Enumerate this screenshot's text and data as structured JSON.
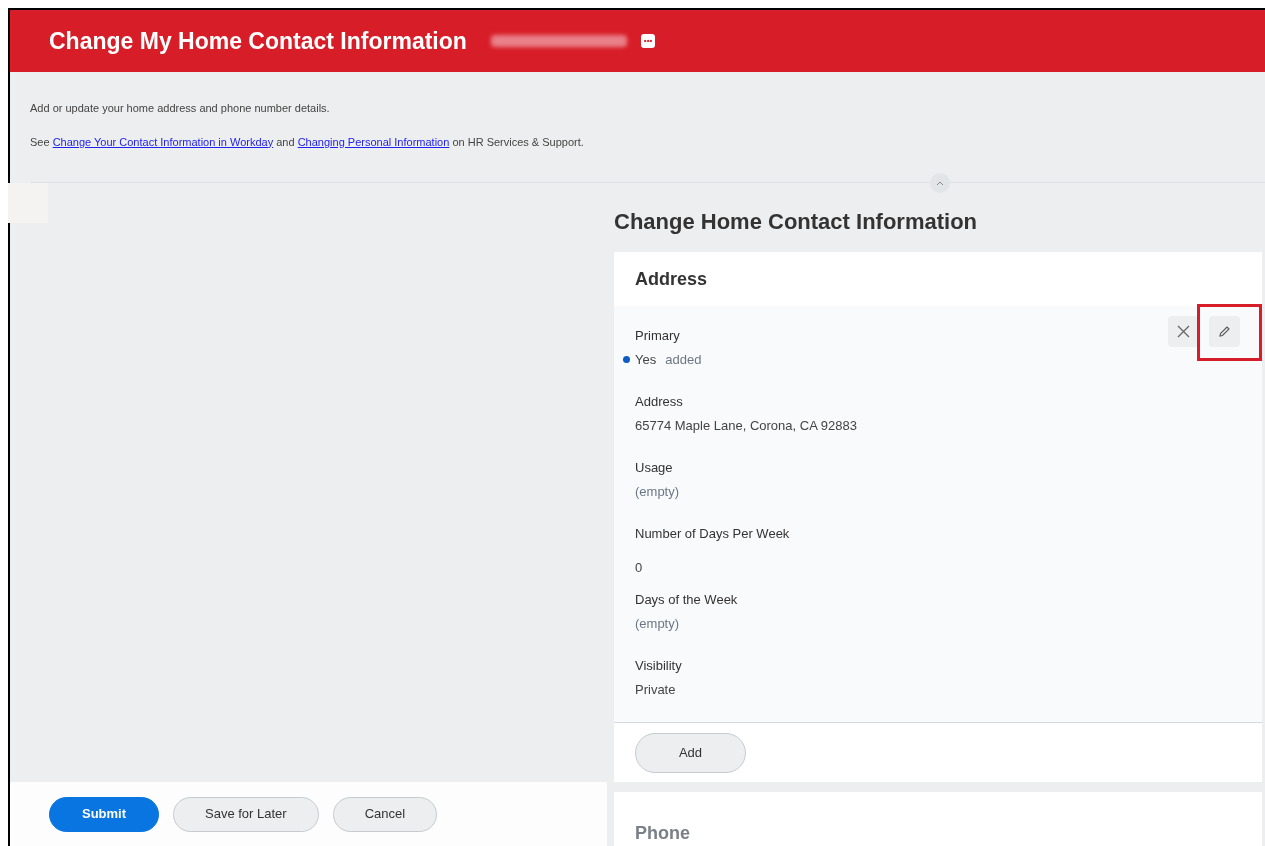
{
  "header": {
    "title": "Change My Home Contact Information",
    "more_button": "•••"
  },
  "intro": {
    "text": "Add or update your home address and phone number details.",
    "see_prefix": "See",
    "link_1": "Change Your Contact Information in Workday",
    "between": "and",
    "link_2": "Changing Personal Information",
    "suffix": "on HR Services & Support."
  },
  "form": {
    "title": "Change Home Contact Information",
    "address_section": {
      "title": "Address",
      "fields": [
        {
          "kind": "changed",
          "label": "Primary",
          "value": "Yes",
          "note": "added"
        },
        {
          "kind": "text",
          "label": "Address",
          "value": "65774 Maple Lane, Corona, CA 92883"
        },
        {
          "kind": "empty",
          "label": "Usage",
          "value": "(empty)"
        },
        {
          "kind": "number",
          "label": "Number of Days Per Week",
          "value": "0"
        },
        {
          "kind": "empty",
          "label": "Days of the Week",
          "value": "(empty)"
        },
        {
          "kind": "text",
          "label": "Visibility",
          "value": "Private"
        }
      ],
      "add_button": "Add"
    },
    "phone_section": {
      "title": "Phone"
    }
  },
  "footer": {
    "buttons": [
      {
        "label": "Submit",
        "kind": "primary"
      },
      {
        "label": "Save for Later",
        "kind": "secondary"
      },
      {
        "label": "Cancel",
        "kind": "secondary"
      }
    ]
  }
}
